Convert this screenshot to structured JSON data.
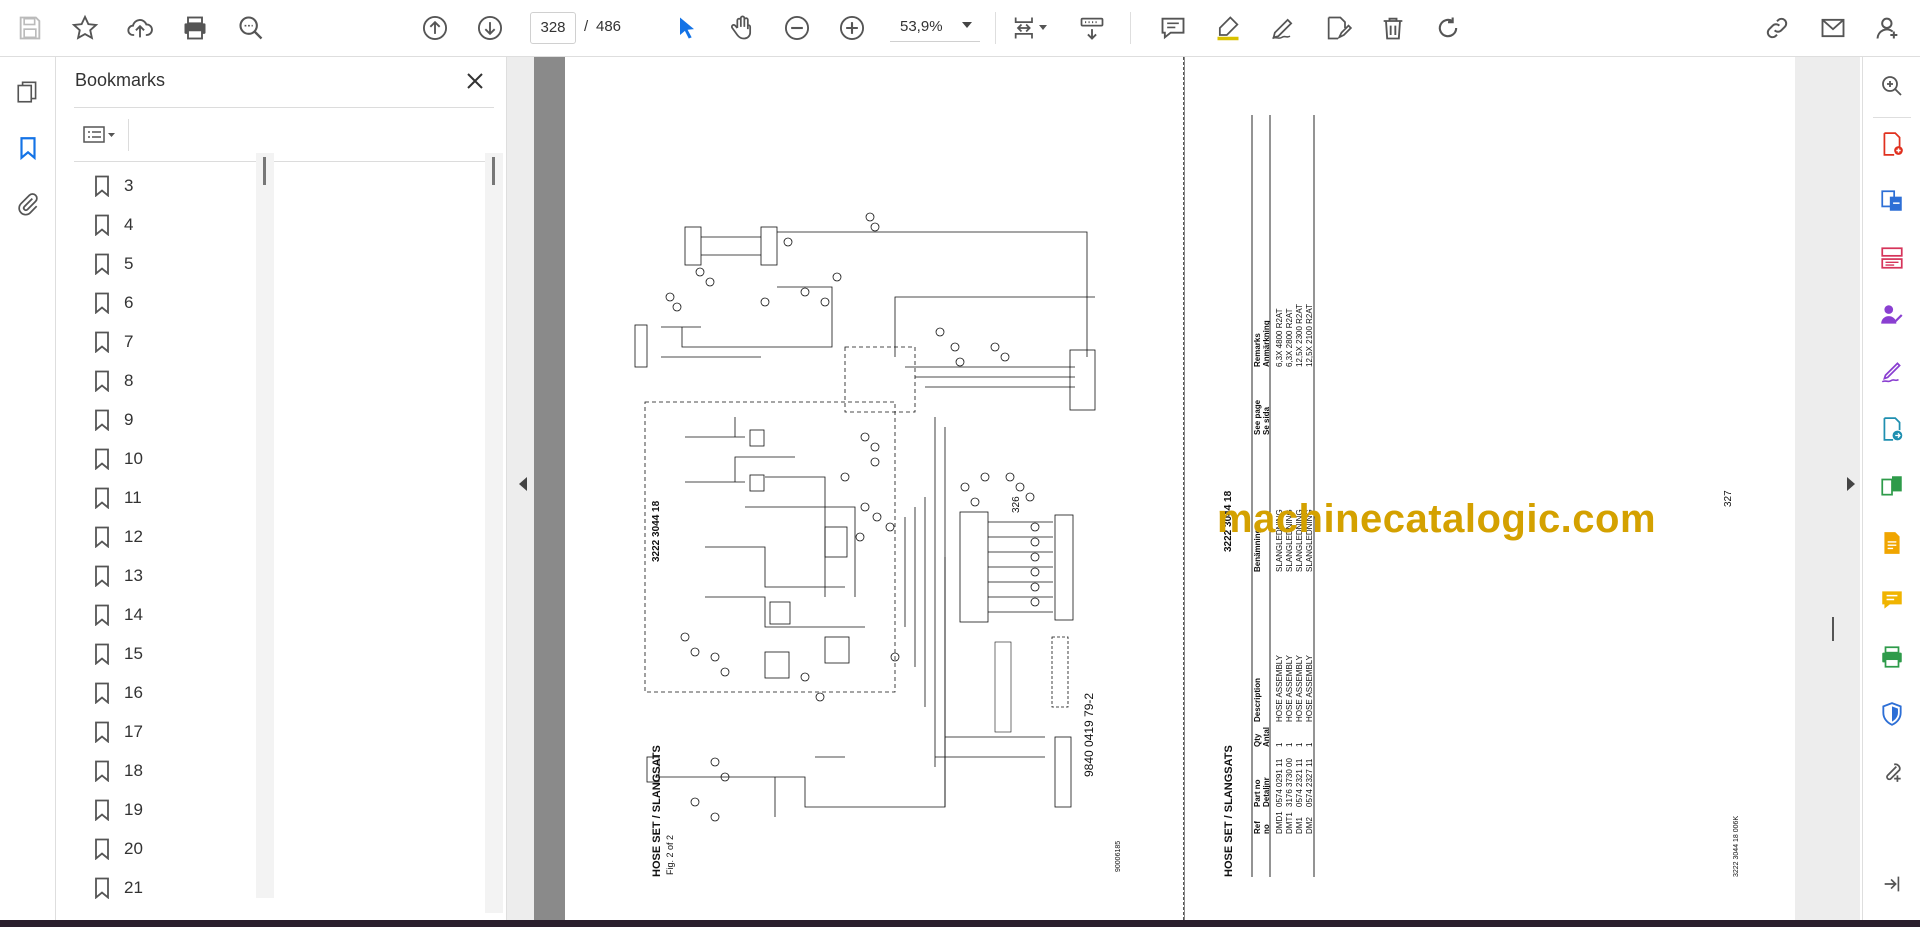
{
  "toolbar": {
    "icons": [
      "save-icon",
      "bookmark-star-icon",
      "upload-cloud-icon",
      "print-icon",
      "search-zoom-icon",
      "page-up-icon",
      "page-down-icon",
      "select-cursor-icon",
      "hand-tool-icon",
      "zoom-out-icon",
      "zoom-in-icon",
      "fit-page-icon",
      "scroll-mode-icon",
      "comment-icon",
      "highlight-icon",
      "draw-icon",
      "fill-sign-icon",
      "delete-icon",
      "rotate-icon",
      "share-link-icon",
      "email-icon",
      "account-icon"
    ],
    "page_current": "328",
    "page_separator": "/",
    "page_total": "486",
    "zoom": "53,9%",
    "accent_color": "#1473e6"
  },
  "bookmarks": {
    "title": "Bookmarks",
    "items": [
      "3",
      "4",
      "5",
      "6",
      "7",
      "8",
      "9",
      "10",
      "11",
      "12",
      "13",
      "14",
      "15",
      "16",
      "17",
      "18",
      "19",
      "20",
      "21"
    ]
  },
  "document": {
    "left_page": {
      "doc_number": "3222 3044 18",
      "title": "HOSE SET / SLANGSATS",
      "fig": "Fig. 2 of 2",
      "page_number": "326",
      "drawing_number": "9840 0419 79-2",
      "image_code": "90006185",
      "watermark": "machinecatalogic.com"
    },
    "right_page": {
      "doc_number": "3222 3044 18",
      "title": "HOSE SET / SLANGSATS",
      "page_number": "327",
      "footer_code": "3222 3044 18   006K",
      "headers": {
        "ref": [
          "Ref",
          "no"
        ],
        "part": [
          "Part no",
          "Detaljnr"
        ],
        "qty": [
          "Qty",
          "Antal"
        ],
        "desc": [
          "Description",
          ""
        ],
        "benamning": [
          "Benämning",
          ""
        ],
        "seepage": [
          "See page",
          "Se sida"
        ],
        "remarks": [
          "Remarks",
          "Anmärkning"
        ]
      },
      "rows": [
        {
          "ref": "DMD1",
          "part": "0574 0291 11",
          "qty": "1",
          "desc": "HOSE ASSEMBLY",
          "benamning": "SLANGLEDNING",
          "remark": "6,3X 4800 R2AT"
        },
        {
          "ref": "DMT1",
          "part": "3176 3730 00",
          "qty": "1",
          "desc": "HOSE ASSEMBLY",
          "benamning": "SLANGLEDNING",
          "remark": "6,3X 2800 R2AT"
        },
        {
          "ref": "DM1",
          "part": "0574 2321 11",
          "qty": "1",
          "desc": "HOSE ASSEMBLY",
          "benamning": "SLANGLEDNING",
          "remark": "12,5X 2300 R2AT"
        },
        {
          "ref": "DM2",
          "part": "0574 2327 11",
          "qty": "1",
          "desc": "HOSE ASSEMBLY",
          "benamning": "SLANGLEDNING",
          "remark": "12,5X 2100 R2AT"
        }
      ]
    }
  },
  "right_tools": [
    "zoom-icon",
    "create-pdf-icon",
    "export-pdf-icon",
    "organize-pages-icon",
    "request-signature-icon",
    "fill-sign-icon",
    "send-review-icon",
    "compare-icon",
    "edit-pdf-icon",
    "comment-icon",
    "print-production-icon",
    "protect-icon",
    "more-tools-icon",
    "collapse-panel-icon"
  ]
}
